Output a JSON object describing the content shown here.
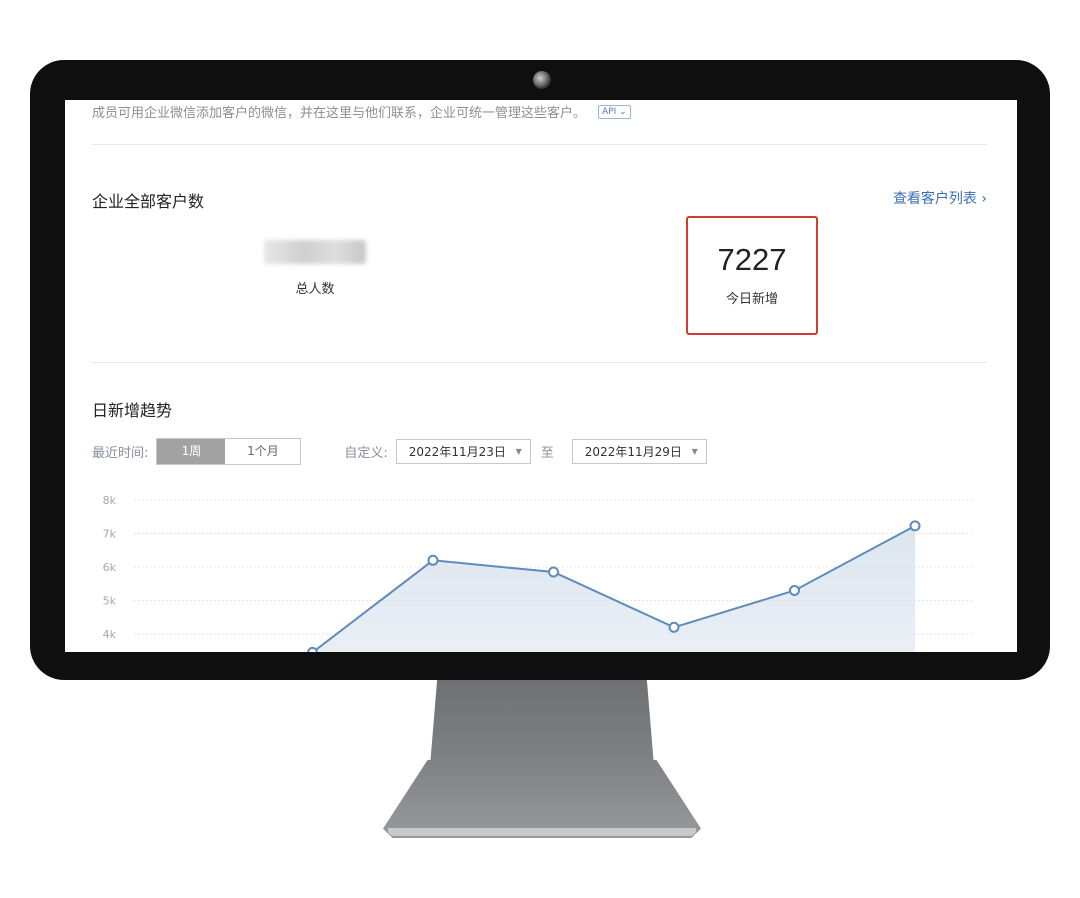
{
  "intro": {
    "text": "成员可用企业微信添加客户的微信，并在这里与他们联系，企业可统一管理这些客户。",
    "api_badge": "API ⌄"
  },
  "customers": {
    "title": "企业全部客户数",
    "view_list_link": "查看客户列表 ›",
    "total_label": "总人数",
    "today_value": "7227",
    "today_label": "今日新增",
    "highlight_color": "#d33a32"
  },
  "trend": {
    "title": "日新增趋势",
    "recent_label": "最近时间:",
    "range_options": [
      "1周",
      "1个月"
    ],
    "selected_range": "1周",
    "custom_label": "自定义:",
    "start_date": "2022年11月23日",
    "end_date": "2022年11月29日",
    "to_label": "至"
  },
  "chart_data": {
    "type": "area",
    "y_ticks": [
      "8k",
      "7k",
      "6k",
      "5k",
      "4k"
    ],
    "ylim": [
      3000,
      8000
    ],
    "x": [
      1,
      2,
      3,
      4,
      5,
      6,
      7
    ],
    "values": [
      3450,
      6200,
      5850,
      4200,
      5300,
      7227
    ],
    "x_index_visible": [
      2,
      3,
      4,
      5,
      6,
      7
    ],
    "line_color": "#5f8bbd",
    "fill_color": "#dbe4ef"
  }
}
